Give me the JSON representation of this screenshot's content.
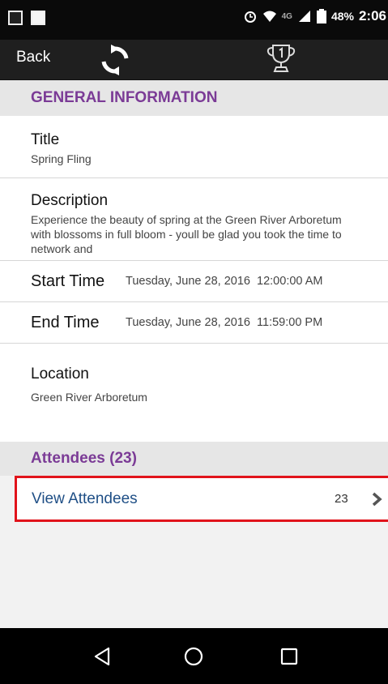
{
  "status_bar": {
    "battery": "48%",
    "time": "2:06",
    "network": "4G"
  },
  "action_bar": {
    "back_label": "Back",
    "icons": [
      "refresh-icon",
      "trophy-icon"
    ]
  },
  "general_information": {
    "header": "GENERAL INFORMATION",
    "title_label": "Title",
    "title_value": "Spring Fling",
    "description_label": "Description",
    "description_value": "Experience the beauty of spring at the Green River Arboretum with blossoms in full bloom - youll be glad you took the time to network and",
    "start_label": "Start Time",
    "start_value": "Tuesday, June 28, 2016  12:00:00 AM",
    "end_label": "End Time",
    "end_value": "Tuesday, June 28, 2016  11:59:00 PM",
    "location_label": "Location",
    "location_value": "Green River Arboretum"
  },
  "attendees": {
    "header": "Attendees (23)",
    "view_label": "View Attendees",
    "count": "23"
  },
  "colors": {
    "accent": "#7b3b96",
    "link": "#1f4f86",
    "highlight_border": "#e1131b"
  }
}
